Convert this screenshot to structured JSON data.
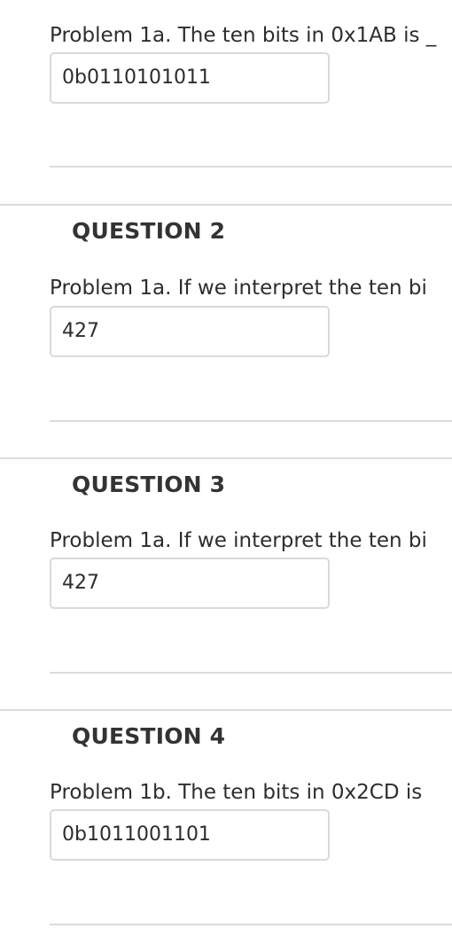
{
  "questions": [
    {
      "title": "",
      "prompt": "Problem 1a. The ten bits in 0x1AB is _",
      "answer": "0b0110101011"
    },
    {
      "title": "QUESTION 2",
      "prompt": "Problem 1a. If we interpret the ten bi",
      "answer": "427"
    },
    {
      "title": "QUESTION 3",
      "prompt": "Problem 1a. If we interpret the ten bi",
      "answer": "427"
    },
    {
      "title": "QUESTION 4",
      "prompt": "Problem 1b. The ten bits in 0x2CD is",
      "answer": "0b1011001101"
    }
  ]
}
